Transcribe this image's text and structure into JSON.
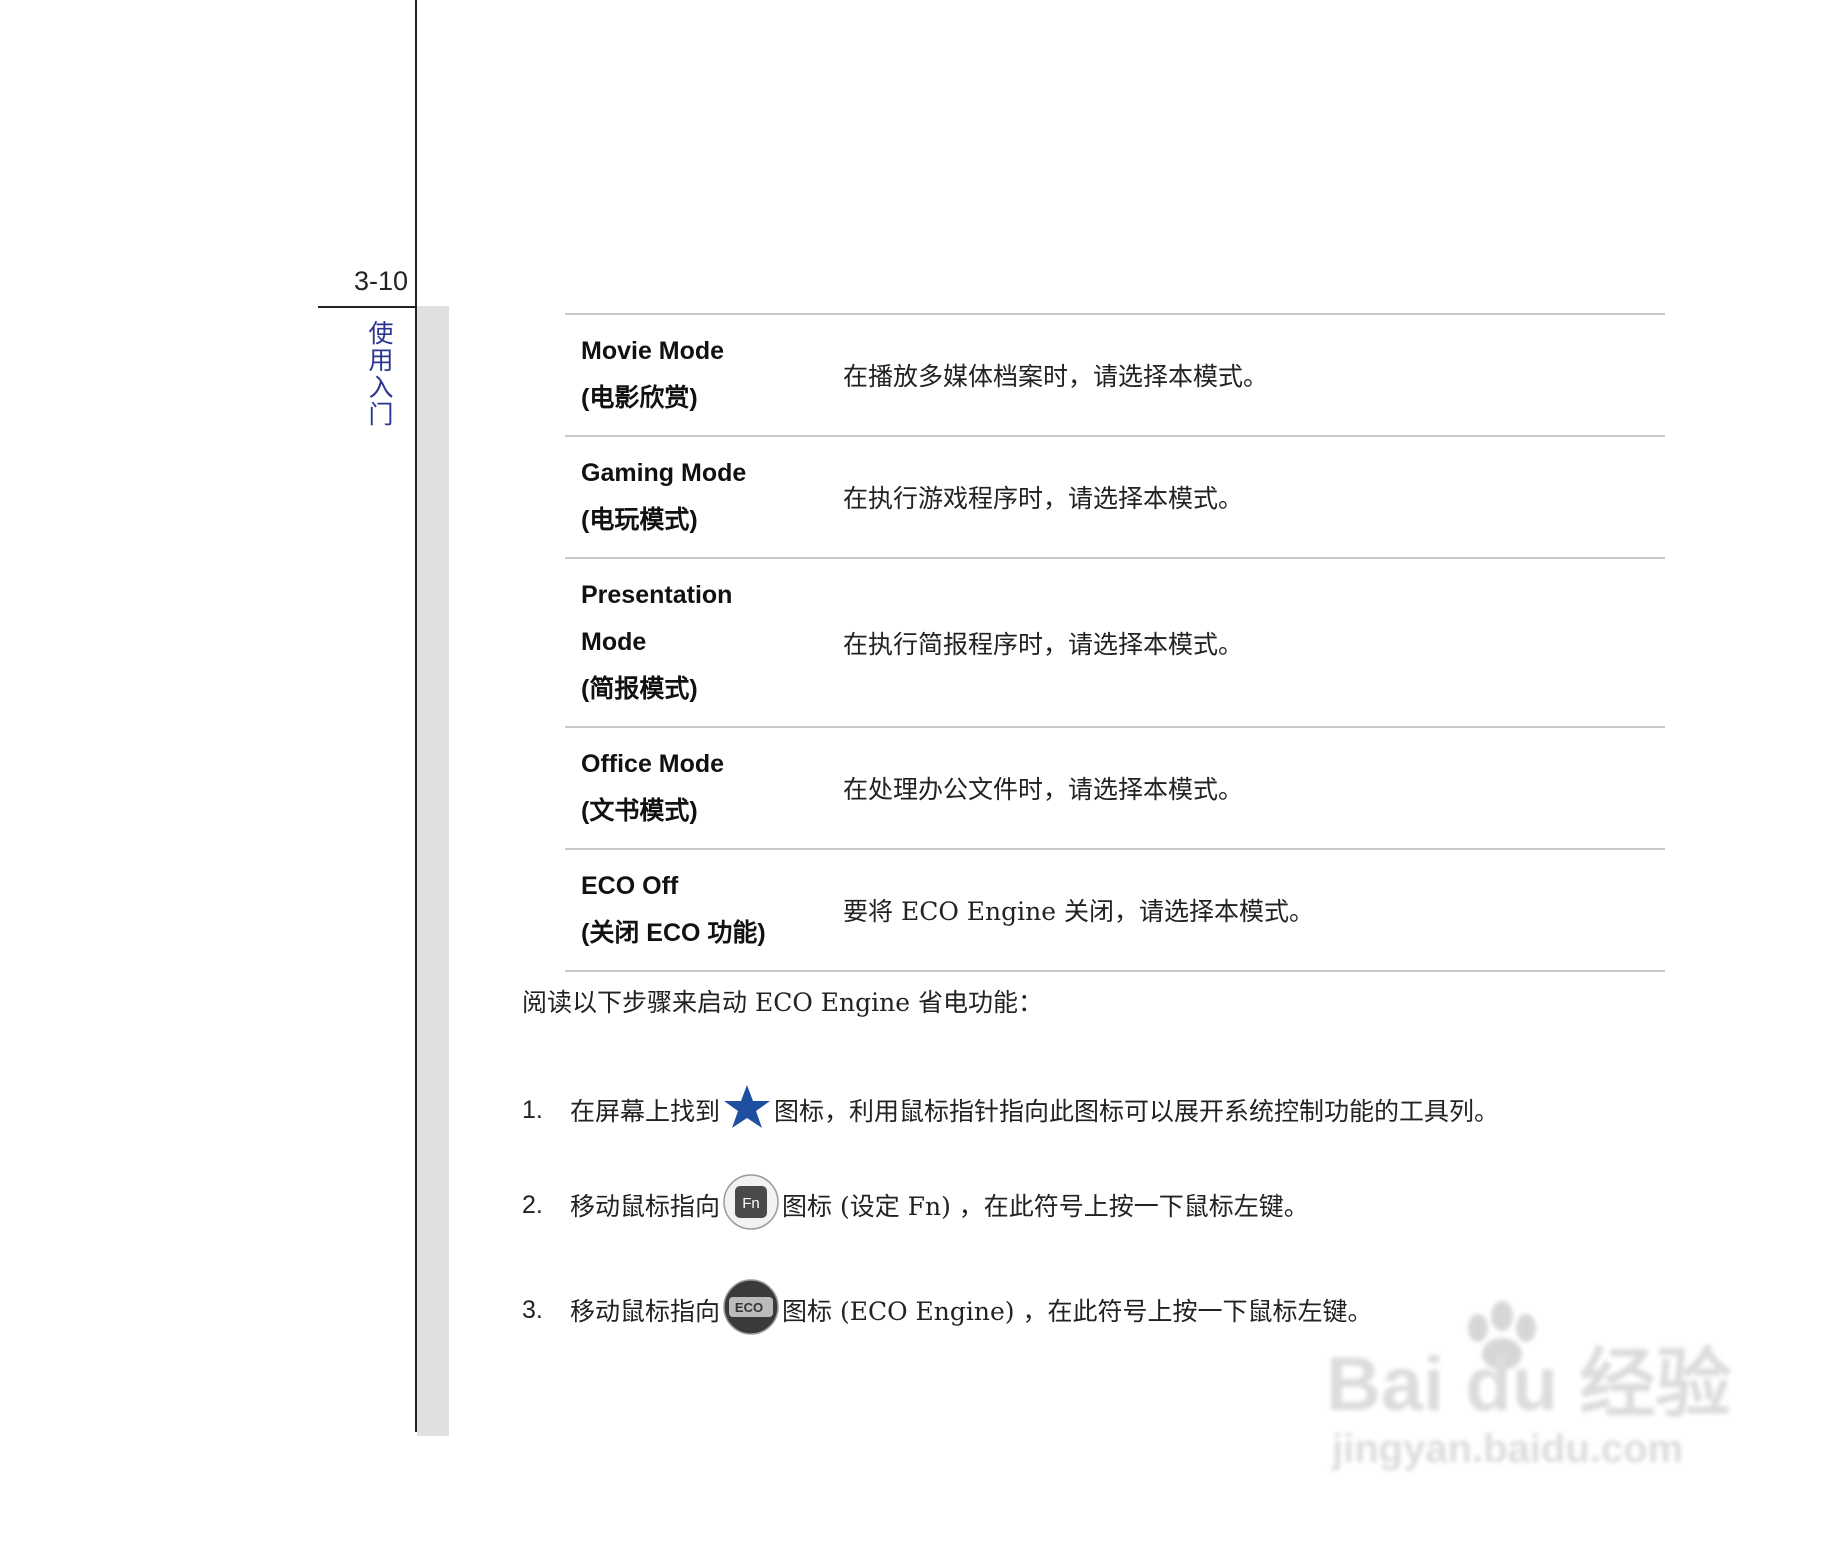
{
  "margin": {
    "page_number": "3-10",
    "section_title": [
      "使",
      "用",
      "入",
      "门"
    ]
  },
  "modes_table": {
    "rows": [
      {
        "name_lines": [
          "Movie Mode",
          "(电影欣赏)"
        ],
        "description": "在播放多媒体档案时，请选择本模式。"
      },
      {
        "name_lines": [
          "Gaming Mode",
          "(电玩模式)"
        ],
        "description": "在执行游戏程序时，请选择本模式。"
      },
      {
        "name_lines": [
          "Presentation",
          "Mode",
          "(简报模式)"
        ],
        "description": "在执行简报程序时，请选择本模式。"
      },
      {
        "name_lines": [
          "Office Mode",
          "(文书模式)"
        ],
        "description": "在处理办公文件时，请选择本模式。"
      },
      {
        "name_lines": [
          "ECO Off",
          "(关闭 ECO 功能)"
        ],
        "description": "要将 ECO Engine 关闭，请选择本模式。"
      }
    ]
  },
  "intro": "阅读以下步骤来启动 ECO Engine 省电功能：",
  "steps": [
    {
      "number": "1.",
      "before": "在屏幕上找到",
      "icon": "star-icon",
      "after": "图标，利用鼠标指针指向此图标可以展开系统控制功能的工具列。"
    },
    {
      "number": "2.",
      "before": "移动鼠标指向",
      "icon": "fn-icon",
      "icon_text": "Fn",
      "after": "图标 (设定  Fn) ，在此符号上按一下鼠标左键。"
    },
    {
      "number": "3.",
      "before": "移动鼠标指向",
      "icon": "eco-icon",
      "icon_text": "ECO",
      "after": "图标  (ECO Engine) ，在此符号上按一下鼠标左键。"
    }
  ],
  "watermark": {
    "logo_text": "Bai du 经验",
    "url_text": "jingyan.baidu.com"
  },
  "colors": {
    "section_title": "#2a3590",
    "star_icon": "#1f4fa0",
    "rule": "#c8c8c8",
    "side_bar": "#e0e0e0"
  }
}
